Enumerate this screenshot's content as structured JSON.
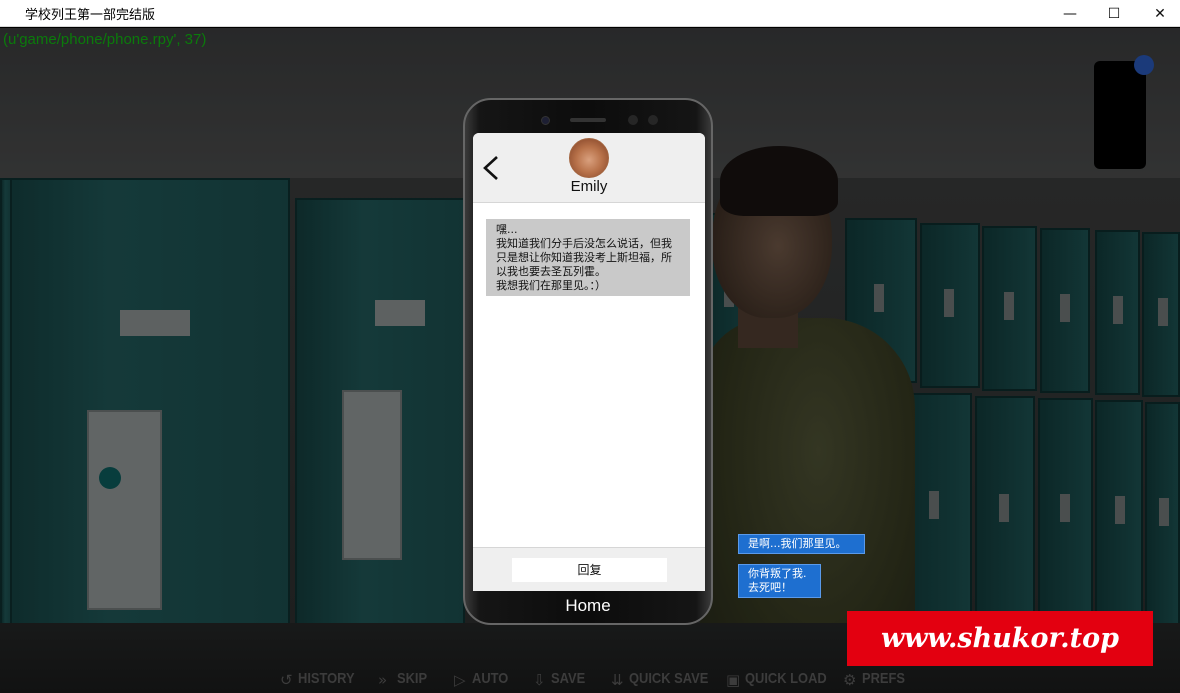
{
  "window": {
    "title": "学校列王第一部完结版",
    "min_glyph": "—",
    "max_glyph": "☐",
    "close_glyph": "✕"
  },
  "debug": {
    "text": "(u'game/phone/phone.rpy', 37)"
  },
  "phone": {
    "contact_name": "Emily",
    "message": "嘿...\n我知道我们分手后没怎么说话，但我只是想让你知道我没考上斯坦福，所以我也要去圣瓦列霍。\n我想我们在那里见。：）",
    "reply_label": "回复",
    "home_label": "Home"
  },
  "choices": [
    {
      "text": "是啊...我们那里见。"
    },
    {
      "text": "你背叛了我.\n去死吧！"
    }
  ],
  "watermark": {
    "text": "www.shukor.top"
  },
  "quick_menu": {
    "history": "HISTORY",
    "skip": "SKIP",
    "auto": "AUTO",
    "save": "SAVE",
    "quick_save": "QUICK SAVE",
    "quick_load": "QUICK LOAD",
    "prefs": "PREFS"
  },
  "colors": {
    "choice_bg": "#1e6fd0",
    "watermark_bg": "#e30010",
    "debug_text": "#0b7a0b",
    "locker": "#1f5555"
  },
  "icons": {
    "back": "back-chevron-icon",
    "history": "history-icon",
    "skip": "skip-icon",
    "auto": "auto-icon",
    "save": "save-icon",
    "quick_save": "quick-save-icon",
    "quick_load": "quick-load-icon",
    "prefs": "prefs-icon"
  }
}
